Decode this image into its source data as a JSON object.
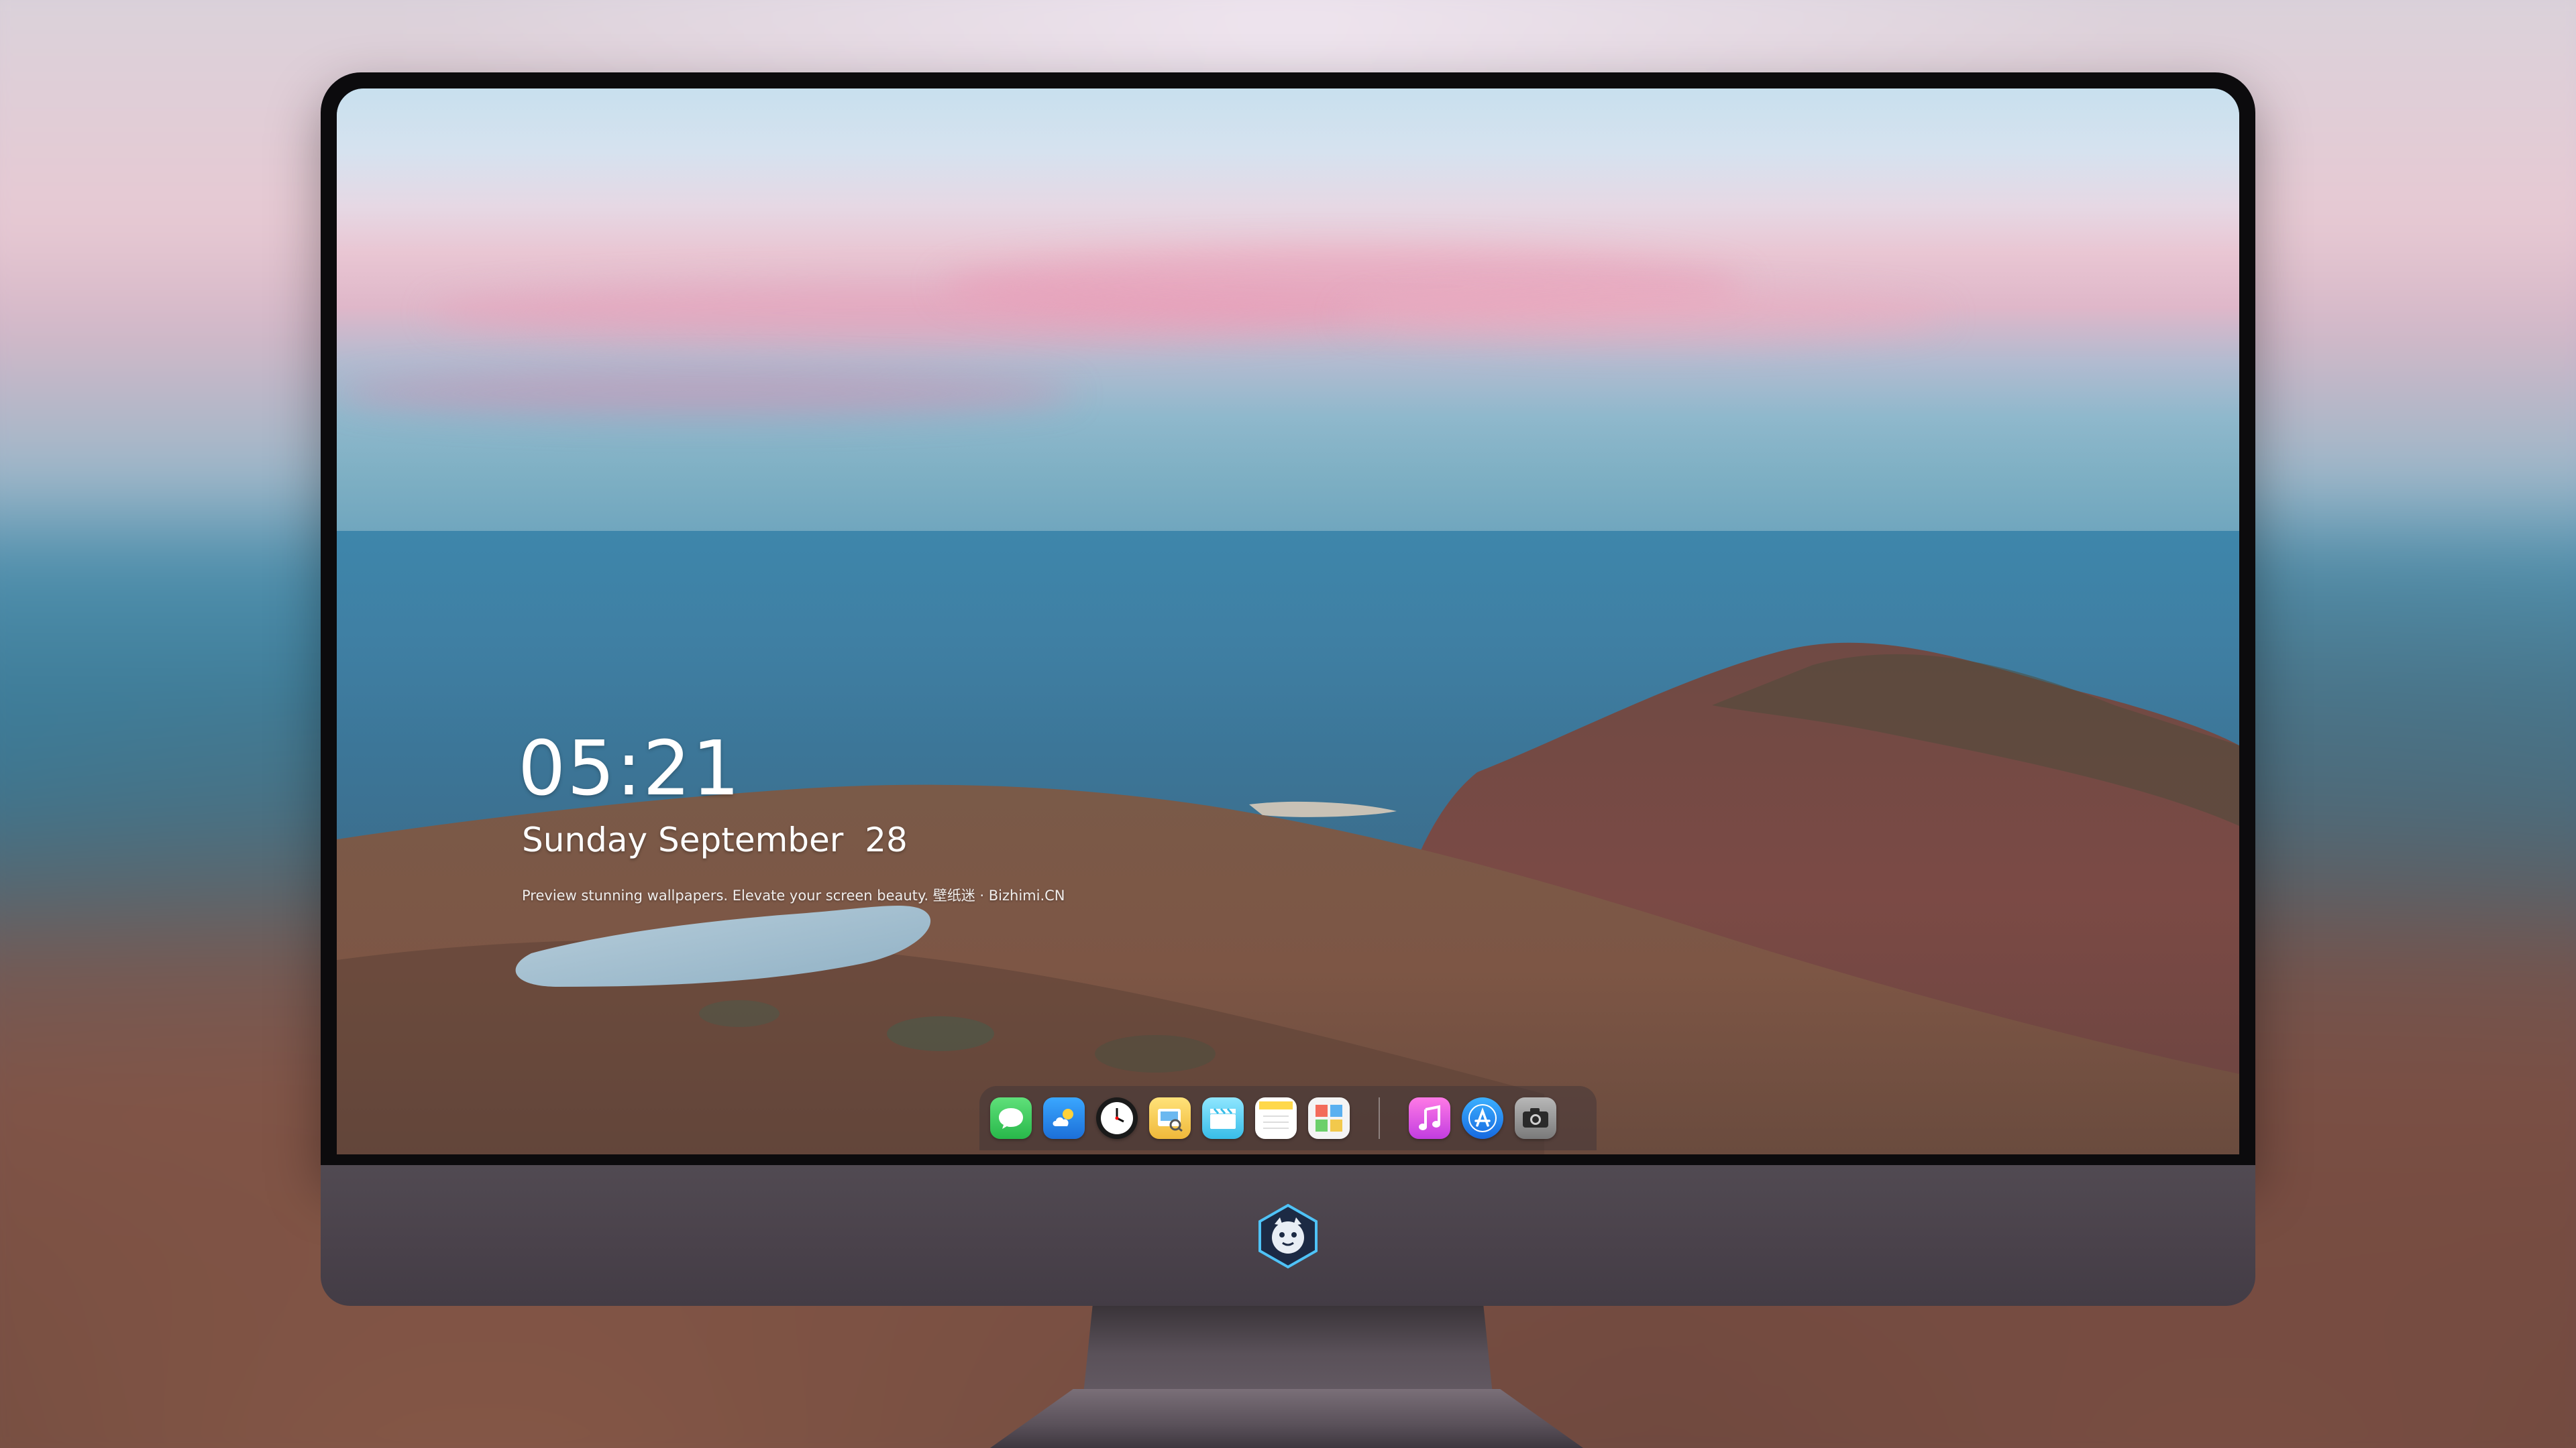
{
  "lock_screen": {
    "time": "05:21",
    "date": "Sunday September  28",
    "tagline": "Preview stunning wallpapers. Elevate your screen beauty. 壁纸迷 · Bizhimi.CN"
  },
  "dock": {
    "items": [
      {
        "name": "messages",
        "icon": "messages-icon",
        "color": "#34c759"
      },
      {
        "name": "weather",
        "icon": "weather-icon",
        "color": "#2f8ff0"
      },
      {
        "name": "clock",
        "icon": "clock-icon",
        "color": "#ffffff"
      },
      {
        "name": "preview",
        "icon": "preview-icon",
        "color": "#f2c94c"
      },
      {
        "name": "clips",
        "icon": "clapperboard-icon",
        "color": "#5ac8fa"
      },
      {
        "name": "notes",
        "icon": "notes-icon",
        "color": "#ffd84a"
      },
      {
        "name": "photo-booth",
        "icon": "photo-grid-icon",
        "color": "#f2f2f2"
      },
      {
        "name": "music",
        "icon": "music-note-icon",
        "color": "#e85ad8"
      },
      {
        "name": "app-store",
        "icon": "app-store-icon",
        "color": "#1e90ff"
      },
      {
        "name": "camera",
        "icon": "camera-icon",
        "color": "#9a9a9a"
      }
    ]
  },
  "monitor": {
    "chin_logo": "dragon-mascot-logo"
  }
}
